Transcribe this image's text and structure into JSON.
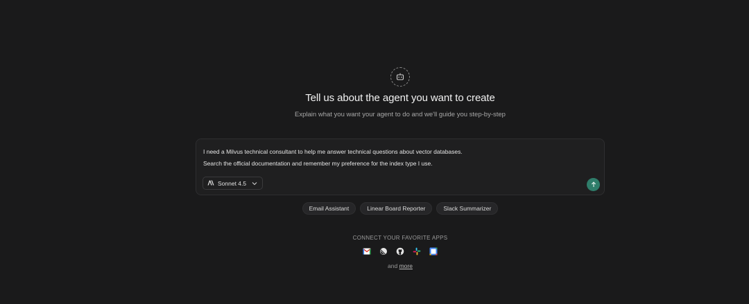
{
  "header": {
    "icon": "agent-icon",
    "title": "Tell us about the agent you want to create",
    "subtitle": "Explain what you want your agent to do and we'll guide you step-by-step"
  },
  "prompt": {
    "line1": "I need a Milvus technical consultant to help me answer technical questions about vector databases.",
    "line2": "Search the official documentation and remember my preference for the index type I use.",
    "model": {
      "label": "Sonnet 4.5",
      "icon": "anthropic-icon"
    },
    "send_icon": "arrow-up-icon",
    "accent_color": "#2f7d6a"
  },
  "suggestions": [
    {
      "label": "Email Assistant"
    },
    {
      "label": "Linear Board Reporter"
    },
    {
      "label": "Slack Summarizer"
    }
  ],
  "connect": {
    "label": "CONNECT YOUR FAVORITE APPS",
    "apps": [
      {
        "name": "gmail-icon"
      },
      {
        "name": "linear-icon"
      },
      {
        "name": "github-icon"
      },
      {
        "name": "slack-icon"
      },
      {
        "name": "google-calendar-icon"
      }
    ],
    "and_text": "and ",
    "more_text": "more"
  }
}
